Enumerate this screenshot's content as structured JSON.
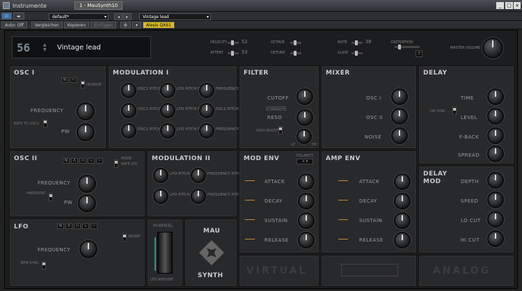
{
  "window": {
    "title": "Instrumente",
    "tab": "1 - MauSynth10"
  },
  "toolbar1": {
    "preset_default": "default*",
    "preset_name": "Vintage lead"
  },
  "toolbar2": {
    "auto": "Auto: Off",
    "compare": "Vergleichen",
    "copy": "Kopieren",
    "paste": "Einfügen",
    "device": "Alesis QX61"
  },
  "display": {
    "preset_number": "56",
    "preset_name": "Vintage lead"
  },
  "top": {
    "velocity_label": "VELOCITY",
    "velocity_val": "53",
    "aftertch_label": "AFTERT",
    "aftertch_val": "53",
    "octave_label": "OCTAVE",
    "detune_label": "DETUNE",
    "note_label": "NOTE",
    "note_val": "38",
    "glide_label": "GLIDE",
    "dist_label": "DISTORTION",
    "dist_val": "7",
    "master_label": "MASTER VOLUME"
  },
  "osc1": {
    "title": "OSC I",
    "freq": "FREQUENCY",
    "pw": "PW",
    "rate_to_osc": "RATE TO OSC2",
    "inverse": "INVERSE"
  },
  "mod1": {
    "title": "MODULATION I",
    "labels": [
      "OSC1 PITCH DEPTH",
      "LFO PITCH DEPTH",
      "FREQUENCY PITCH DEPTH",
      "OSC2 PITCH DEPTH",
      "LFO PITCH DEPTH",
      "OSC2 PITCH DEPTH",
      "OSC1 PITCH DEPTH",
      "LFO PITCH DEPTH",
      "FREQUENCY PITCH DEPTH"
    ]
  },
  "filter": {
    "title": "FILTER",
    "cutoff": "CUTOFF",
    "reso": "RESO",
    "highboost": "HIGH BOOST",
    "mode": "SCHMOOTH",
    "lp": "LP",
    "hp": "HP"
  },
  "mixer": {
    "title": "MIXER",
    "osc1": "OSC I",
    "osc2": "OSC II",
    "noise": "NOISE"
  },
  "delay": {
    "title": "DELAY",
    "time": "TIME",
    "level": "LEVEL",
    "fback": "F-BACK",
    "spread": "SPREAD",
    "sync": "ON SYNC"
  },
  "osc2": {
    "title": "OSC II",
    "freq": "FREQUENCY",
    "pw": "PW",
    "hardsync": "HARDSYNC",
    "mode": "MODE",
    "rate": "RATE LFO"
  },
  "mod2": {
    "title": "MODULATION II",
    "labels": [
      "LFO PITCH DEPTH",
      "FREQUENCY PITCH DEPTH",
      "LFO PITCH DEPTH",
      "FREQUENCY PITCH DEPTH"
    ]
  },
  "modenv": {
    "title": "MOD ENV",
    "attack": "ATTACK",
    "decay": "DECAY",
    "sustain": "SUSTAIN",
    "release": "RELEASE",
    "polarity": "POLARITY"
  },
  "ampenv": {
    "title": "AMP ENV",
    "attack": "ATTACK",
    "decay": "DECAY",
    "sustain": "SUSTAIN",
    "release": "RELEASE"
  },
  "delaymod": {
    "title1": "DELAY",
    "title2": "MOD",
    "depth": "DEPTH",
    "speed": "SPEED",
    "locut": "LO CUT",
    "hicut": "HI CUT"
  },
  "lfo": {
    "title": "LFO",
    "freq": "FREQUENCY",
    "bpm": "BPM SYNC",
    "invert": "INVERT"
  },
  "mwheel": {
    "label": "M-WHEEL",
    "sub": "LFO AMOUNT"
  },
  "logo": {
    "line1": "MAU",
    "line2": "SYNTH"
  },
  "bottom": {
    "virtual": "VIRTUAL",
    "analog": "ANALOG"
  }
}
